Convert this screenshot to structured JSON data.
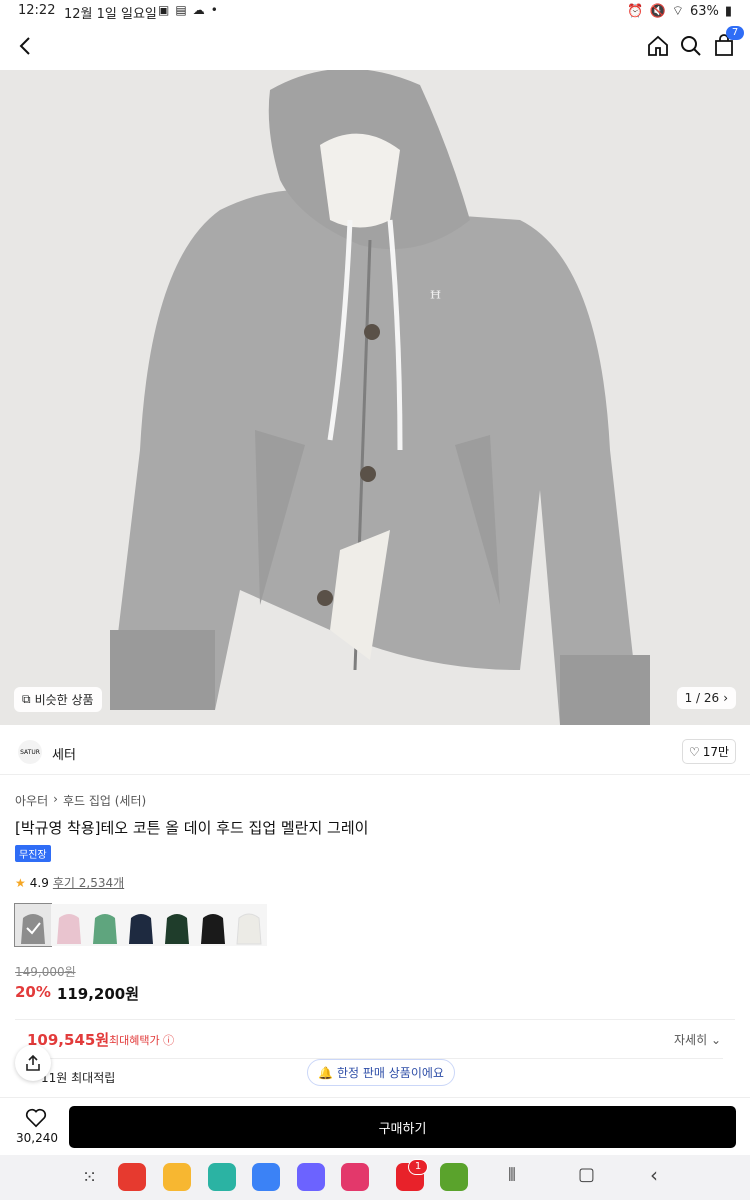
{
  "status": {
    "time": "12:22",
    "date": "12월 1일 일요일",
    "battery": "63%"
  },
  "cart_count": "7",
  "hero": {
    "similar": "비슷한 상품",
    "counter": "1 / 26"
  },
  "brand": {
    "name": "세터",
    "likes": "17만",
    "logo_text": "SATUR"
  },
  "breadcrumb": [
    "아우터",
    "후드 집업 (세터)"
  ],
  "product": {
    "title": "[박규영 착용]테오 코튼 올 데이 후드 집업 멜란지 그레이",
    "tag": "무진장",
    "rating": "4.9",
    "reviews": "후기 2,534개",
    "original_price": "149,000원",
    "discount": "20%",
    "price": "119,200원"
  },
  "swatches": [
    {
      "color": "#8d8d8d"
    },
    {
      "color": "#e9c4cf"
    },
    {
      "color": "#5fa57e"
    },
    {
      "color": "#1e2a40"
    },
    {
      "color": "#1f3d2b"
    },
    {
      "color": "#1a1a1a"
    },
    {
      "color": "#ecebe6"
    }
  ],
  "benefit": {
    "max_price": "109,545원",
    "max_label": "최대혜택가",
    "detail": "자세히",
    "points": "11원 최대적립"
  },
  "limited": "한정 판매 상품이에요",
  "bottom": {
    "likes": "30,240",
    "buy": "구매하기"
  },
  "nav": {
    "badge": "1"
  }
}
